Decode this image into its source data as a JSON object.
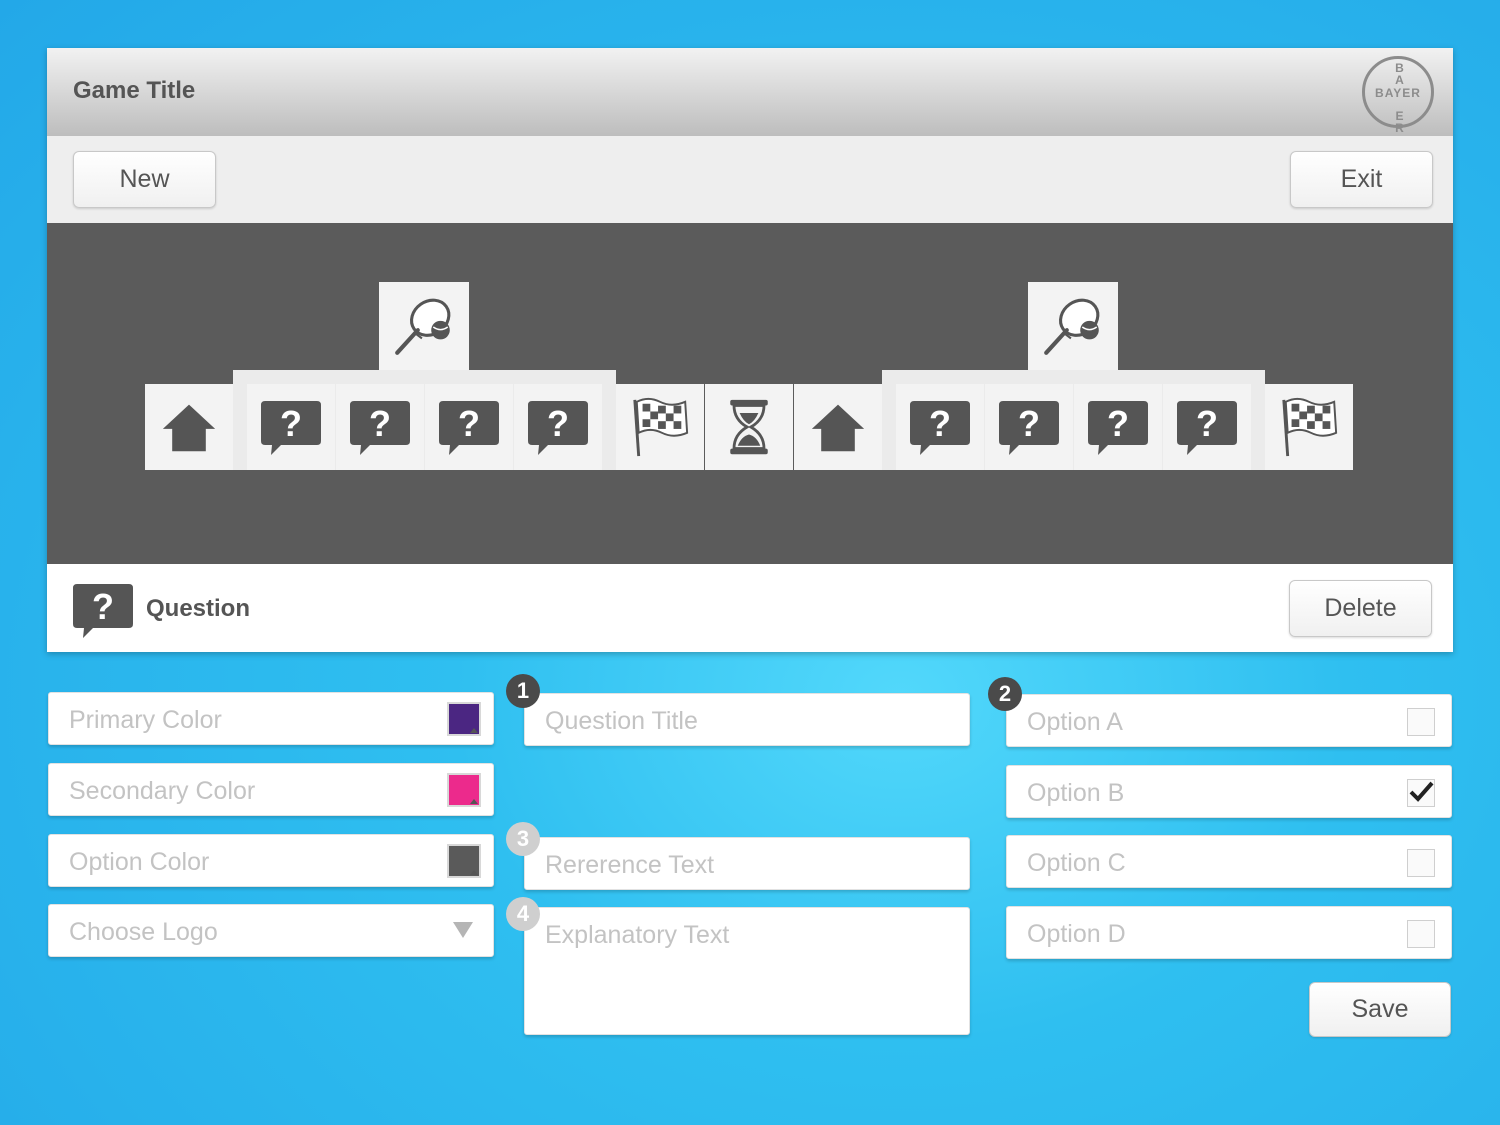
{
  "header": {
    "title": "Game Title",
    "logo_text_h": "BAYER",
    "logo_text_v": "BAER"
  },
  "toolbar": {
    "new_label": "New",
    "exit_label": "Exit"
  },
  "board": {
    "groups": [
      {
        "tiles": [
          "home-icon",
          "question-icon",
          "question-icon",
          "question-icon",
          "question-icon",
          "checkered-flag-icon"
        ],
        "bonus": "tennis-racket-icon"
      },
      {
        "tiles": [
          "hourglass-icon"
        ]
      },
      {
        "tiles": [
          "home-icon",
          "question-icon",
          "question-icon",
          "question-icon",
          "question-icon",
          "checkered-flag-icon"
        ],
        "bonus": "tennis-racket-icon"
      }
    ]
  },
  "selection": {
    "icon": "question-icon",
    "label": "Question",
    "delete_label": "Delete"
  },
  "style_fields": {
    "primary_color": {
      "placeholder": "Primary Color",
      "color": "#4b2682"
    },
    "secondary_color": {
      "placeholder": "Secondary Color",
      "color": "#ec2a8c"
    },
    "option_color": {
      "placeholder": "Option Color",
      "color": "#5a5a5a"
    },
    "logo": {
      "placeholder": "Choose Logo"
    }
  },
  "question_fields": {
    "step1": "1",
    "title_placeholder": "Question Title",
    "step3": "3",
    "reference_placeholder": "Rererence Text",
    "step4": "4",
    "explanatory_placeholder": "Explanatory Text"
  },
  "options": {
    "step2": "2",
    "items": [
      {
        "label": "Option A",
        "checked": false
      },
      {
        "label": "Option B",
        "checked": true
      },
      {
        "label": "Option C",
        "checked": false
      },
      {
        "label": "Option D",
        "checked": false
      }
    ],
    "save_label": "Save"
  },
  "colors": {
    "board_bg": "#5b5b5b",
    "icon": "#555555"
  }
}
